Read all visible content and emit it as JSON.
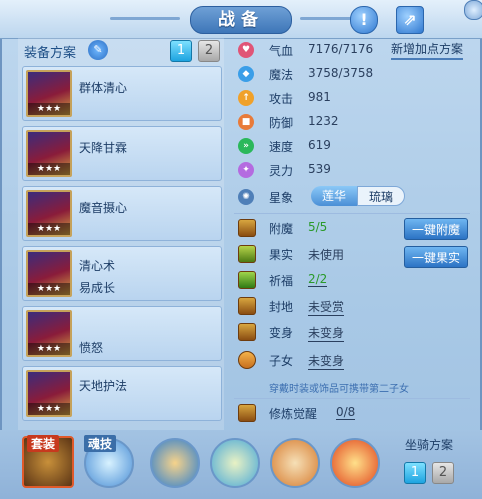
{
  "window": {
    "title": "战备"
  },
  "plans": {
    "label": "装备方案",
    "pages": [
      "1",
      "2"
    ],
    "active_page": "1",
    "items": [
      {
        "name": "群体清心",
        "stars": "★★★"
      },
      {
        "name": "天降甘霖",
        "stars": "★★★"
      },
      {
        "name": "魔音摄心",
        "stars": "★★★"
      },
      {
        "name": "清心术",
        "name2": "易成长",
        "stars": "★★★"
      },
      {
        "name": "愤怒",
        "stars": "★★★"
      },
      {
        "name": "天地护法",
        "stars": "★★★"
      }
    ]
  },
  "stats": {
    "new_plan_link": "新增加点方案",
    "rows": [
      {
        "label": "气血",
        "value": "7176/7176",
        "icon": "heart-icon",
        "color": "#e05577"
      },
      {
        "label": "魔法",
        "value": "3758/3758",
        "icon": "mana-icon",
        "color": "#3a9ee8"
      },
      {
        "label": "攻击",
        "value": "981",
        "icon": "attack-icon",
        "color": "#f0a12a"
      },
      {
        "label": "防御",
        "value": "1232",
        "icon": "defense-icon",
        "color": "#e87b3a"
      },
      {
        "label": "速度",
        "value": "619",
        "icon": "speed-icon",
        "color": "#2bb85b"
      },
      {
        "label": "灵力",
        "value": "539",
        "icon": "spirit-icon",
        "color": "#b46be0"
      }
    ],
    "constellation": {
      "label": "星象",
      "tab1": "莲华",
      "tab2": "琉璃"
    }
  },
  "enhance": {
    "rows": [
      {
        "label": "附魔",
        "value": "5/5"
      },
      {
        "label": "果实",
        "value": "未使用"
      },
      {
        "label": "祈福",
        "value": "2/2"
      },
      {
        "label": "封地",
        "value": "未受赏"
      },
      {
        "label": "变身",
        "value": "未变身"
      },
      {
        "label": "子女",
        "value": "未变身"
      }
    ],
    "enchant_button": "一键附魔",
    "fruit_button": "一键果实",
    "hint": "穿戴时装或饰品可携带第二子女",
    "awaken": {
      "label": "修炼觉醒",
      "value": "0/8"
    }
  },
  "bottom": {
    "suit_label": "套装",
    "soul_label": "魂技",
    "mount_label": "坐骑方案",
    "mount_pages": [
      "1",
      "2"
    ]
  }
}
